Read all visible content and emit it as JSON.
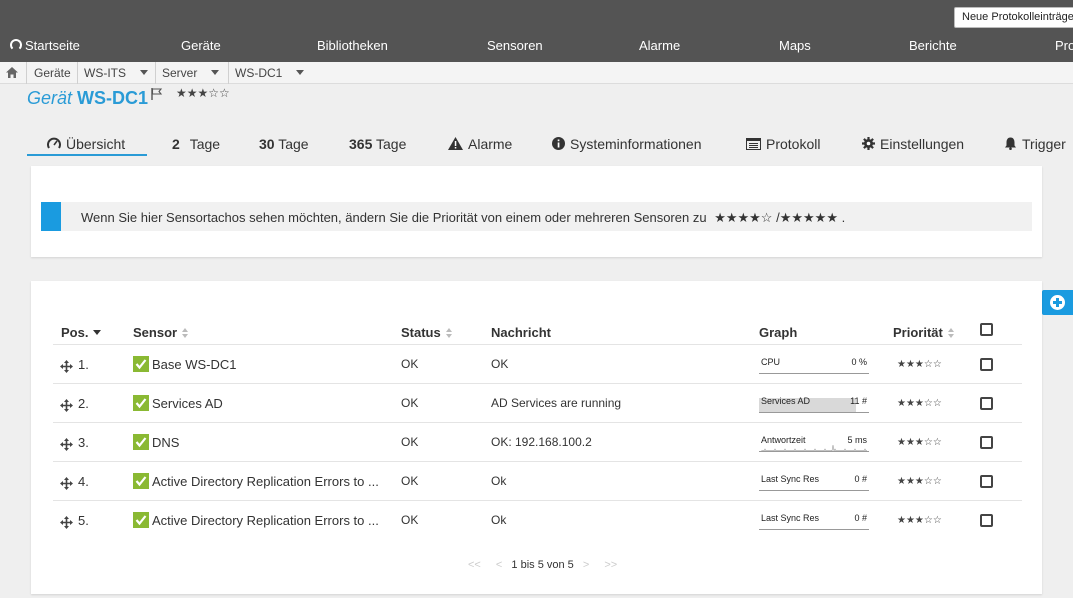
{
  "header": {
    "new_log_button": "Neue Protokolleinträge",
    "nav": [
      "Startseite",
      "Geräte",
      "Bibliotheken",
      "Sensoren",
      "Alarme",
      "Maps",
      "Berichte",
      "Pro"
    ]
  },
  "breadcrumb": [
    "Geräte",
    "WS-ITS",
    "Server",
    "WS-DC1"
  ],
  "title": {
    "prefix": "Gerät",
    "name": "WS-DC1",
    "priority_stars": "★★★☆☆"
  },
  "tabs": [
    {
      "num": "",
      "label": "Übersicht",
      "icon": "gauge-icon"
    },
    {
      "num": "2",
      "label": "Tage",
      "icon": ""
    },
    {
      "num": "30",
      "label": "Tage",
      "icon": ""
    },
    {
      "num": "365",
      "label": "Tage",
      "icon": ""
    },
    {
      "num": "",
      "label": "Alarme",
      "icon": "warning-icon"
    },
    {
      "num": "",
      "label": "Systeminformationen",
      "icon": "info-icon"
    },
    {
      "num": "",
      "label": "Protokoll",
      "icon": "log-icon"
    },
    {
      "num": "",
      "label": "Einstellungen",
      "icon": "gear-icon"
    },
    {
      "num": "",
      "label": "Trigger",
      "icon": "bell-icon"
    }
  ],
  "info": {
    "text": "Wenn Sie hier Sensortachos sehen möchten, ändern Sie die Priorität von einem oder mehreren Sensoren zu",
    "stars_a": "★★★★☆",
    "separator": "/",
    "stars_b": "★★★★★",
    "end": "."
  },
  "table": {
    "headers": {
      "pos": "Pos.",
      "sensor": "Sensor",
      "status": "Status",
      "message": "Nachricht",
      "graph": "Graph",
      "priority": "Priorität"
    },
    "rows": [
      {
        "pos": "1.",
        "sensor": "Base WS-DC1",
        "status": "OK",
        "message": "OK",
        "graph_label": "CPU",
        "graph_value": "0 %",
        "graph_fill": 0,
        "stars": "★★★☆☆"
      },
      {
        "pos": "2.",
        "sensor": "Services AD",
        "status": "OK",
        "message": "AD Services are running",
        "graph_label": "Services AD",
        "graph_value": "11 #",
        "graph_fill": 0.88,
        "stars": "★★★☆☆"
      },
      {
        "pos": "3.",
        "sensor": "DNS",
        "status": "OK",
        "message": "OK: 192.168.100.2",
        "graph_label": "Antwortzeit",
        "graph_value": "5 ms",
        "graph_fill": 0,
        "stars": "★★★☆☆"
      },
      {
        "pos": "4.",
        "sensor": "Active Directory Replication Errors to ...",
        "status": "OK",
        "message": "Ok",
        "graph_label": "Last Sync Res",
        "graph_value": "0 #",
        "graph_fill": 0,
        "stars": "★★★☆☆"
      },
      {
        "pos": "5.",
        "sensor": "Active Directory Replication Errors to ...",
        "status": "OK",
        "message": "Ok",
        "graph_label": "Last Sync Res",
        "graph_value": "0 #",
        "graph_fill": 0,
        "stars": "★★★☆☆"
      }
    ]
  },
  "pager": {
    "first": "<<",
    "prev": "<",
    "text": "1 bis 5 von 5",
    "next": ">",
    "last": ">>"
  },
  "colors": {
    "accent": "#1a9be0",
    "ok_check": "#8ab933",
    "header_bg": "#545454"
  }
}
